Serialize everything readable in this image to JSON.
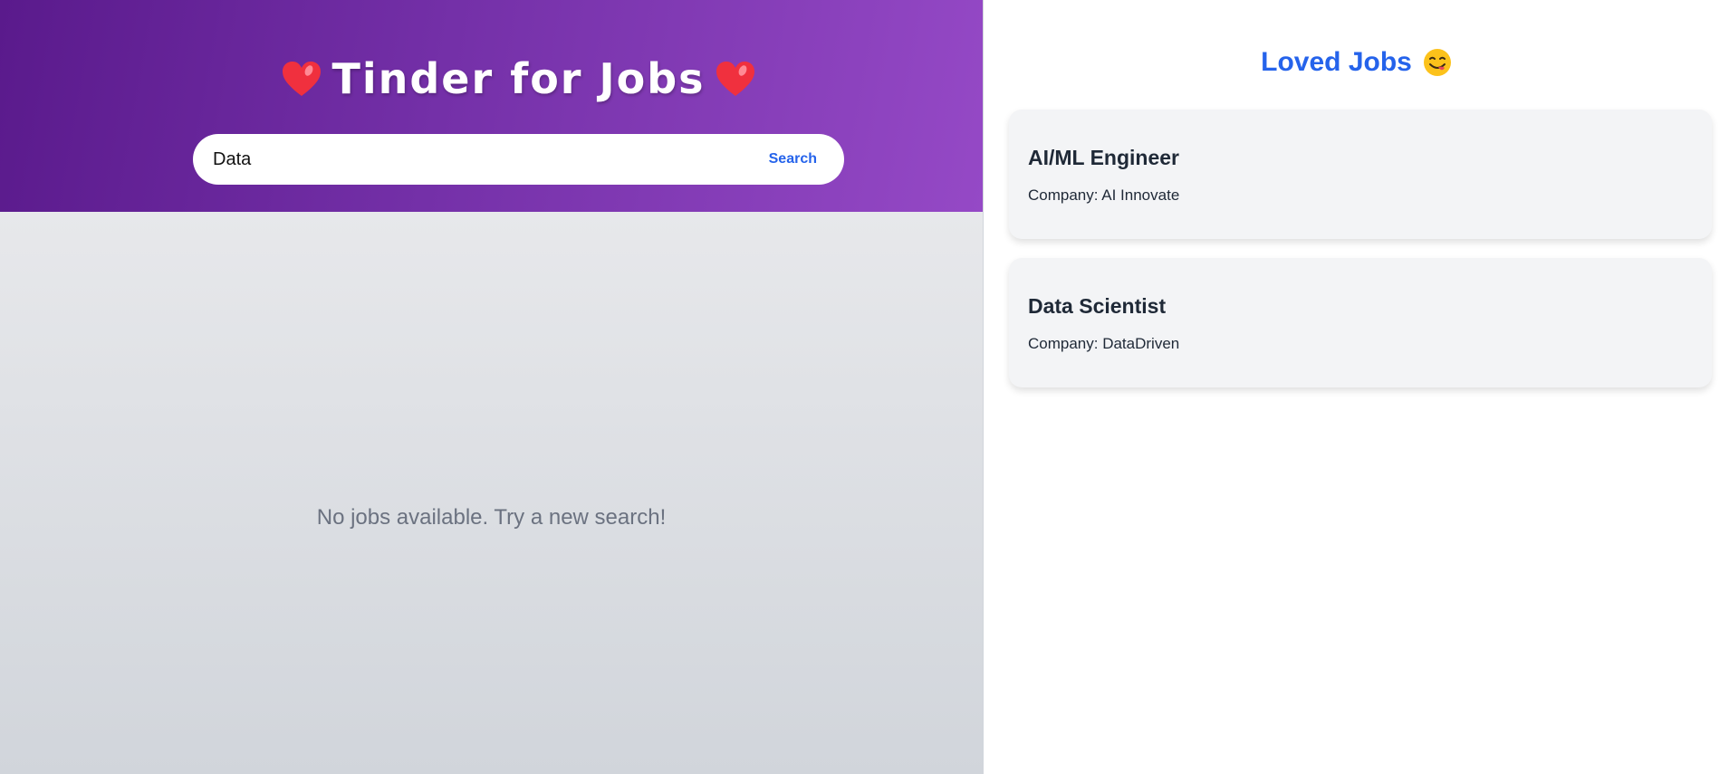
{
  "header": {
    "title": "Tinder for Jobs",
    "title_icon_left": "heart-icon",
    "title_icon_right": "heart-icon"
  },
  "search": {
    "value": "Data",
    "button_label": "Search"
  },
  "deck": {
    "empty_message": "No jobs available. Try a new search!"
  },
  "loved": {
    "title": "Loved Jobs",
    "title_icon": "face-savoring-food-emoji-icon",
    "jobs": [
      {
        "title": "AI/ML Engineer",
        "company": "Company: AI Innovate"
      },
      {
        "title": "Data Scientist",
        "company": "Company: DataDriven"
      }
    ]
  },
  "colors": {
    "header_gradient_start": "#5a1a8c",
    "header_gradient_end": "#9549c6",
    "accent_blue": "#2563eb",
    "heart_red": "#f0303e",
    "card_bg": "#f3f4f6"
  }
}
